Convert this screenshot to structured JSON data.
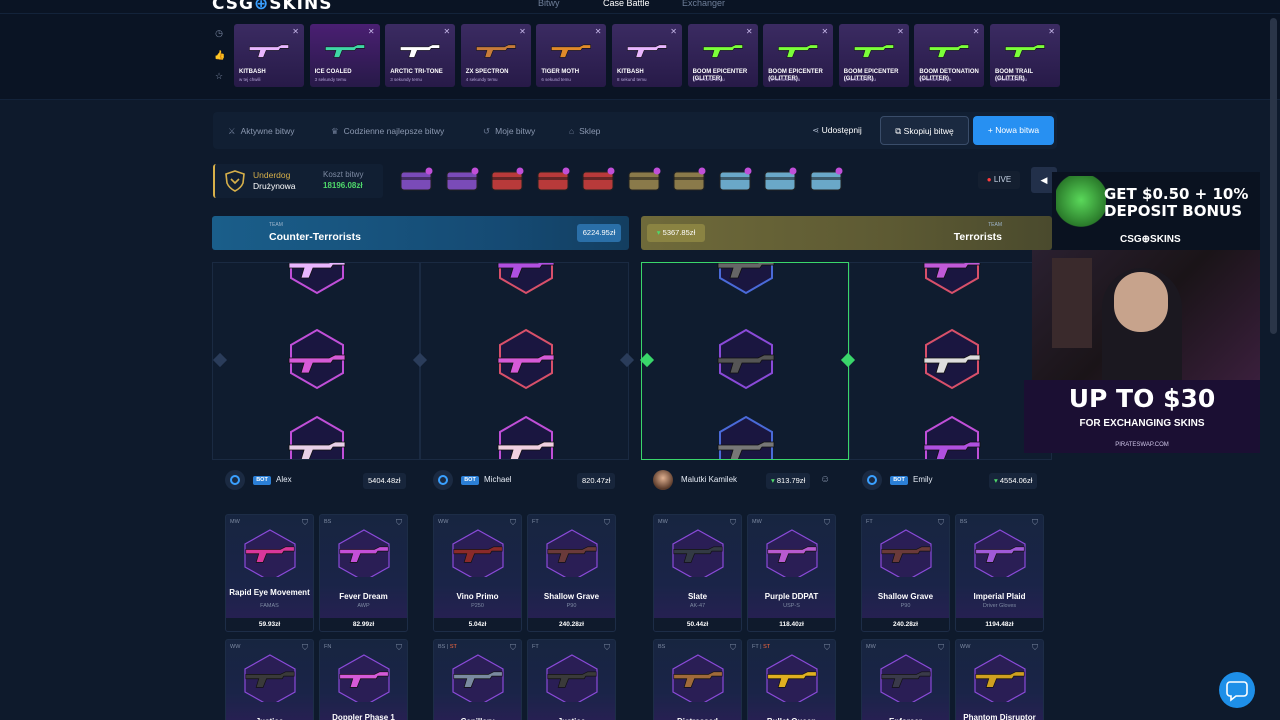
{
  "brand": {
    "name_a": "CSG",
    "name_b": "SKINS"
  },
  "nav": [
    "Bitwy",
    "Case Battle",
    "Exchanger"
  ],
  "feed": [
    {
      "name": "KITBASH",
      "sub": "w tej chwili",
      "color": "#3b2b62",
      "gun": "#e9b6ff"
    },
    {
      "name": "ICE COALED",
      "sub": "3 sekundy temu",
      "color": "#4a1f72",
      "gun": "#3fd6a6"
    },
    {
      "name": "ARCTIC TRI-TONE",
      "sub": "3 sekundy temu",
      "color": "#3b2b62",
      "gun": "#ffffff"
    },
    {
      "name": "ZX SPECTRON",
      "sub": "4 sekundy temu",
      "color": "#3b2b62",
      "gun": "#c77b3a"
    },
    {
      "name": "TIGER MOTH",
      "sub": "6 sekund temu",
      "color": "#3b2b62",
      "gun": "#e08a2a"
    },
    {
      "name": "KITBASH",
      "sub": "8 sekund temu",
      "color": "#3b2b62",
      "gun": "#e9b6ff"
    },
    {
      "name": "BOOM EPICENTER (GLITTER)",
      "sub": "10 sekund temu",
      "color": "#3b2b62",
      "gun": "#7bff3a"
    },
    {
      "name": "BOOM EPICENTER (GLITTER)",
      "sub": "10 sekund temu",
      "color": "#3b2b62",
      "gun": "#7bff3a"
    },
    {
      "name": "BOOM EPICENTER (GLITTER)",
      "sub": "10 sekund temu",
      "color": "#3b2b62",
      "gun": "#7bff3a"
    },
    {
      "name": "BOOM DETONATION (GLITTER)",
      "sub": "10 sekund temu",
      "color": "#3b2b62",
      "gun": "#7bff3a"
    },
    {
      "name": "BOOM TRAIL (GLITTER)",
      "sub": "10 sekund temu",
      "color": "#3b2b62",
      "gun": "#7bff3a"
    }
  ],
  "tabs": [
    {
      "icon": "⚔",
      "label": "Aktywne bitwy"
    },
    {
      "icon": "♛",
      "label": "Codzienne najlepsze bitwy"
    },
    {
      "icon": "↺",
      "label": "Moje bitwy"
    },
    {
      "icon": "⌂",
      "label": "Sklep"
    }
  ],
  "actions": {
    "share": "Udostępnij",
    "copy": "Skopiuj bitwę",
    "new": "Nowa bitwa"
  },
  "battle": {
    "mode": "Underdog",
    "type": "Drużynowa",
    "cost_label": "Koszt bitwy",
    "cost": "18196.08zł",
    "live": "LIVE"
  },
  "cases": [
    "#7a4bb8",
    "#7a4bb8",
    "#b83a3a",
    "#b83a3a",
    "#b83a3a",
    "#8a7a4a",
    "#8a7a4a",
    "#6aa8c8",
    "#6aa8c8",
    "#6aa8c8"
  ],
  "teams": {
    "ct": {
      "label": "TEAM",
      "name": "Counter-Terrorists",
      "value": "6224.95zł"
    },
    "t": {
      "label": "TEAM",
      "name": "Terrorists",
      "value": "5367.85zł"
    }
  },
  "players": [
    {
      "bot": "BOT",
      "name": "Alex",
      "value": "5404.48zł"
    },
    {
      "bot": "BOT",
      "name": "Michael",
      "value": "820.47zł"
    },
    {
      "bot": "",
      "name": "Malutki Kamilek",
      "value": "813.79zł"
    },
    {
      "bot": "BOT",
      "name": "Emily",
      "value": "4554.06zł"
    }
  ],
  "items": [
    {
      "cond": "MW",
      "st": "",
      "name": "Rapid Eye Movement",
      "sub": "FAMAS",
      "price": "59.93zł",
      "color": "#d9379b"
    },
    {
      "cond": "BS",
      "st": "",
      "name": "Fever Dream",
      "sub": "AWP",
      "price": "82.99zł",
      "color": "#c44fd8"
    },
    {
      "cond": "WW",
      "st": "",
      "name": "Vino Primo",
      "sub": "P250",
      "price": "5.04zł",
      "color": "#8a2a2a"
    },
    {
      "cond": "FT",
      "st": "",
      "name": "Shallow Grave",
      "sub": "P90",
      "price": "240.28zł",
      "color": "#6a3a3a"
    },
    {
      "cond": "MW",
      "st": "",
      "name": "Slate",
      "sub": "AK-47",
      "price": "50.44zł",
      "color": "#333a44"
    },
    {
      "cond": "MW",
      "st": "",
      "name": "Purple DDPAT",
      "sub": "USP-S",
      "price": "118.40zł",
      "color": "#b85ad0"
    },
    {
      "cond": "FT",
      "st": "",
      "name": "Shallow Grave",
      "sub": "P90",
      "price": "240.28zł",
      "color": "#6a3a3a"
    },
    {
      "cond": "BS",
      "st": "",
      "name": "Imperial Plaid",
      "sub": "Driver Gloves",
      "price": "1194.48zł",
      "color": "#a05ad8"
    },
    {
      "cond": "WW",
      "st": "",
      "name": "Justice",
      "sub": "",
      "price": "",
      "color": "#3a3a3a"
    },
    {
      "cond": "FN",
      "st": "",
      "name": "Doppler Phase 1",
      "sub": "",
      "price": "",
      "color": "#d65ad8"
    },
    {
      "cond": "BS",
      "st": "ST",
      "name": "Capillary",
      "sub": "",
      "price": "",
      "color": "#7a8aa0"
    },
    {
      "cond": "FT",
      "st": "",
      "name": "Justice",
      "sub": "",
      "price": "",
      "color": "#3a3a3a"
    },
    {
      "cond": "BS",
      "st": "",
      "name": "Distressed",
      "sub": "",
      "price": "",
      "color": "#a06a3a"
    },
    {
      "cond": "FT",
      "st": "ST",
      "name": "Bullet Queen",
      "sub": "",
      "price": "",
      "color": "#e0b020"
    },
    {
      "cond": "MW",
      "st": "",
      "name": "Enforcer",
      "sub": "",
      "price": "",
      "color": "#3a3a4a"
    },
    {
      "cond": "WW",
      "st": "",
      "name": "Phantom Disruptor",
      "sub": "",
      "price": "",
      "color": "#d0a020"
    }
  ],
  "promo": {
    "line1": "GET $0.50 + 10%",
    "line2": "DEPOSIT BONUS",
    "brand": "CSG⊕SKINS",
    "big": "UP TO $30",
    "small": "FOR EXCHANGING SKINS",
    "url": "PIRATESWAP.COM"
  }
}
